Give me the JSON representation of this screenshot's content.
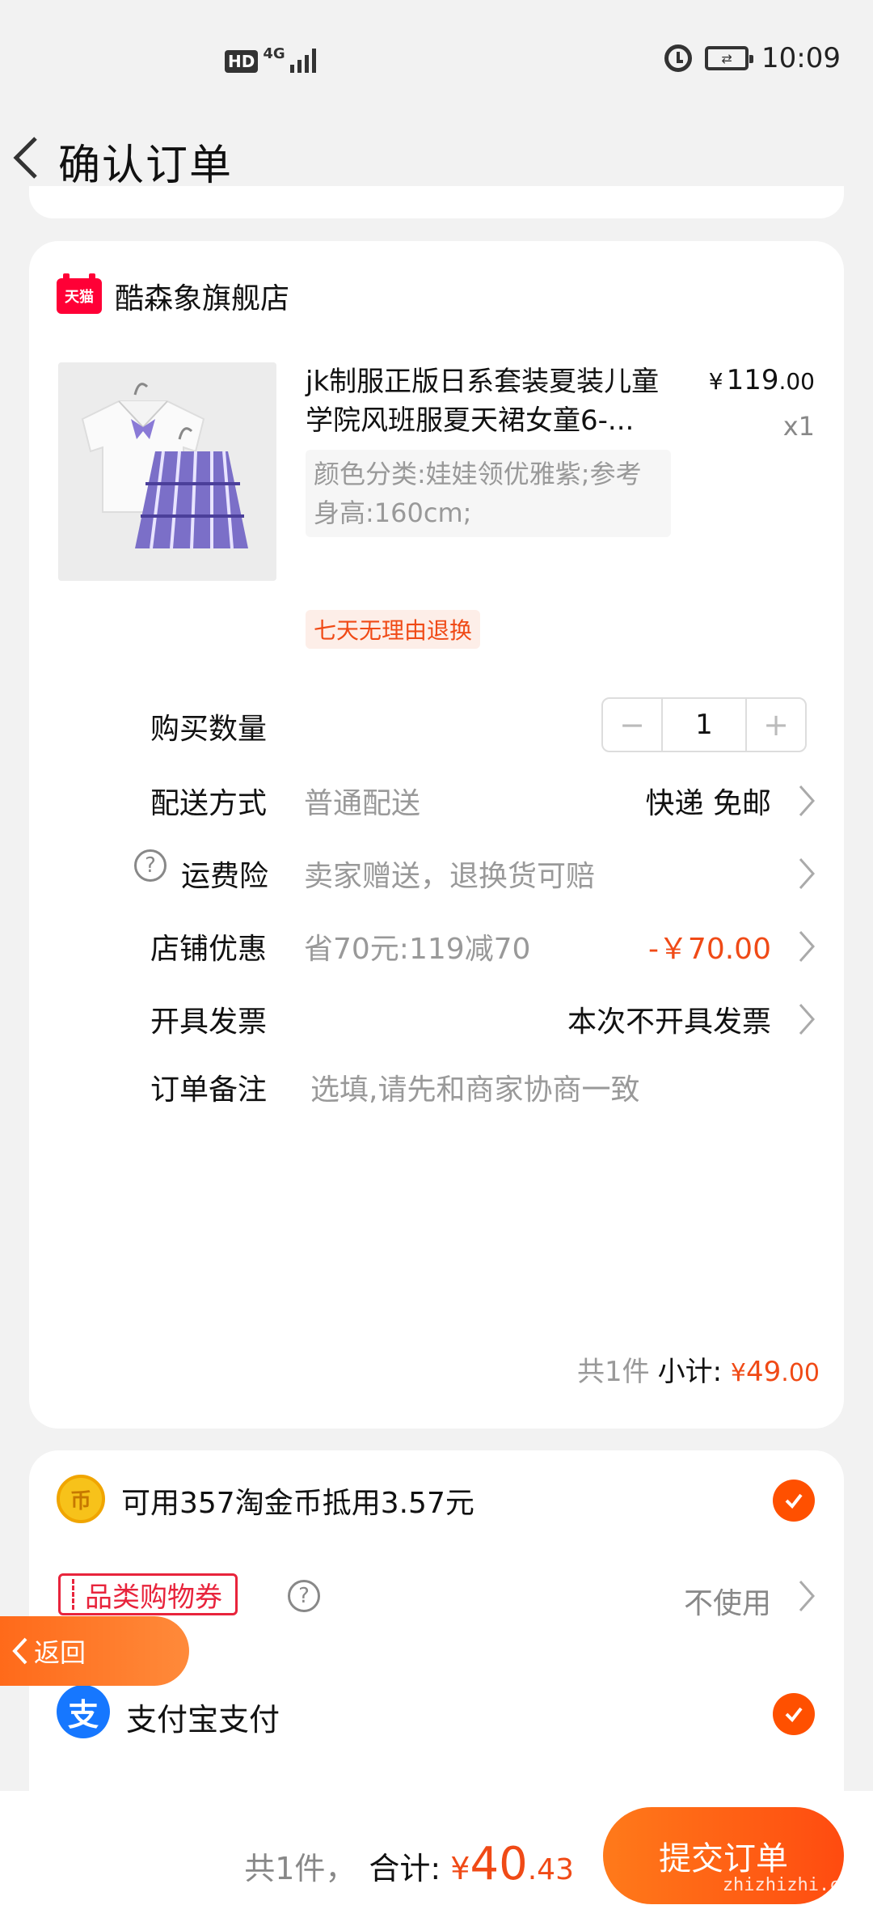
{
  "status_bar": {
    "hd": "HD",
    "network": "4G",
    "time": "10:09"
  },
  "header": {
    "title": "确认订单"
  },
  "shop": {
    "badge": "天猫",
    "name": "酷森象旗舰店"
  },
  "product": {
    "title": "jk制服正版日系套装夏装儿童学院风班服夏天裙女童6-...",
    "price_symbol": "¥",
    "price_int": "119",
    "price_dec": ".00",
    "quantity_label": "x1",
    "sku": "颜色分类:娃娃领优雅紫;参考身高:160cm;",
    "tag": "七天无理由退换"
  },
  "quantity": {
    "label": "购买数量",
    "value": "1",
    "minus": "−",
    "plus": "+"
  },
  "delivery": {
    "label": "配送方式",
    "sub": "普通配送",
    "value": "快递 免邮"
  },
  "insurance": {
    "label": "运费险",
    "sub": "卖家赠送，退换货可赔",
    "help": "?"
  },
  "shop_discount": {
    "label": "店铺优惠",
    "sub": "省70元:119减70",
    "value": "-￥70.00"
  },
  "invoice": {
    "label": "开具发票",
    "value": "本次不开具发票"
  },
  "remark": {
    "label": "订单备注",
    "placeholder": "选填,请先和商家协商一致"
  },
  "subtotal": {
    "count": "共1件",
    "label": "小计:",
    "symbol": "¥",
    "int": "49",
    "dec": ".00"
  },
  "coins": {
    "text": "可用357淘金币抵用3.57元",
    "icon": "币"
  },
  "coupon": {
    "label": "品类购物券",
    "help": "?",
    "value": "不使用"
  },
  "payment": {
    "icon": "支",
    "label": "支付宝支付"
  },
  "float_back": {
    "label": "返回"
  },
  "footer": {
    "count": "共1件，",
    "label": "合计:",
    "symbol": "¥",
    "int": "40",
    "dec": ".43",
    "submit": "提交订单",
    "watermark": "zhizhizhi.com"
  },
  "colors": {
    "accent": "#ff5000",
    "price_red": "#f04a16",
    "tmall_red": "#ff0036",
    "alipay_blue": "#1677ff"
  }
}
